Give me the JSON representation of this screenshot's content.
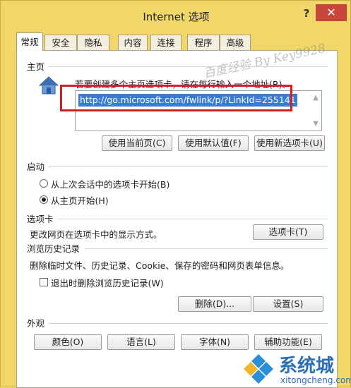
{
  "window": {
    "title": "Internet 选项",
    "help": "?",
    "close": "✕"
  },
  "tabs": [
    "常规",
    "安全",
    "隐私",
    "内容",
    "连接",
    "程序",
    "高级"
  ],
  "watermark": "百度经验 By Key9928",
  "home": {
    "label": "主页",
    "hint": "若要创建多个主页选项卡，请在每行输入一个地址(R)。",
    "url": "http://go.microsoft.com/fwlink/p/?LinkId=255141",
    "buttons": [
      "使用当前页(C)",
      "使用默认值(F)",
      "使用新选项卡(U)"
    ]
  },
  "startup": {
    "label": "启动",
    "option_last": "从上次会话中的选项卡开始(B)",
    "option_home": "从主页开始(H)",
    "selected": "option_home"
  },
  "tabsec": {
    "label": "选项卡",
    "desc": "更改网页在选项卡中的显示方式。",
    "button": "选项卡(T)"
  },
  "history": {
    "label": "浏览历史记录",
    "desc": "删除临时文件、历史记录、Cookie、保存的密码和网页表单信息。",
    "checkbox": "退出时删除浏览历史记录(W)",
    "delete_button": "删除(D)...",
    "settings_button": "设置(S)"
  },
  "appearance": {
    "label": "外观",
    "buttons": [
      "颜色(O)",
      "语言(L)",
      "字体(N)",
      "辅助功能(E)"
    ]
  },
  "logo": {
    "name": "系统城",
    "site": "xitongcheng.com"
  },
  "colors": {
    "frame": "#f1d769",
    "close": "#c8453b",
    "highlight": "#d21f1f",
    "selection": "#3a7bd5",
    "logo": "#2a6fb6"
  }
}
